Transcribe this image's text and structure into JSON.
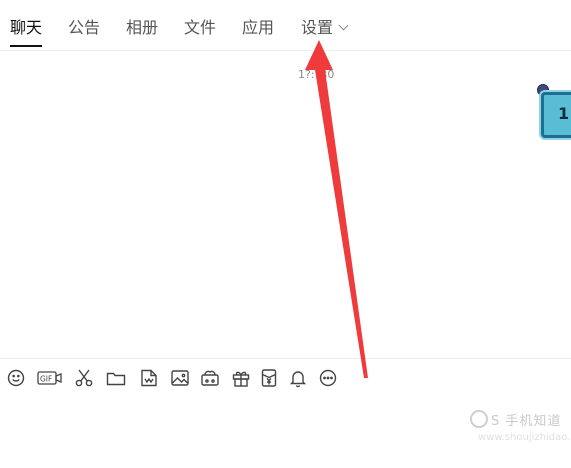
{
  "tabs": [
    {
      "label": "聊天",
      "active": true
    },
    {
      "label": "公告"
    },
    {
      "label": "相册"
    },
    {
      "label": "文件"
    },
    {
      "label": "应用"
    },
    {
      "label": "设置"
    }
  ],
  "chat": {
    "timestamp": "1?:?30",
    "sticker_text": "1"
  },
  "toolbar": {
    "icons": [
      "emoji-icon",
      "gif-icon",
      "scissors-icon",
      "folder-icon",
      "doc-icon",
      "image-icon",
      "cloud-image-icon",
      "gift-icon",
      "red-packet-icon",
      "bell-icon",
      "more-icon"
    ]
  },
  "annotation": {
    "color": "#ef3b3b"
  },
  "watermark": {
    "text": "S 手机知道",
    "sub": "www.shoujizhidao.com"
  }
}
